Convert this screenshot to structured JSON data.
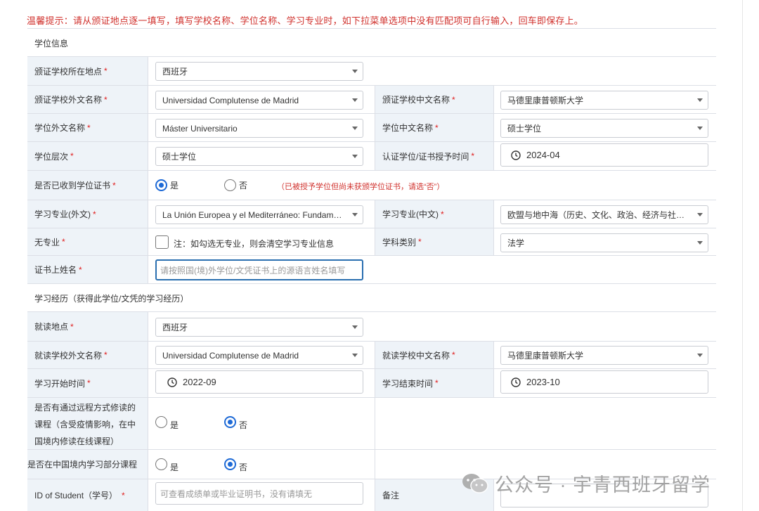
{
  "notice": "温馨提示：请从颁证地点逐一填写，填写学校名称、学位名称、学习专业时，如下拉菜单选项中没有匹配项可自行输入，回车即保存上。",
  "sections": {
    "degree_info": "学位信息",
    "study_history": "学习经历（获得此学位/文凭的学习经历）"
  },
  "required_mark": "*",
  "degree": {
    "location_label": "颁证学校所在地点",
    "location_value": "西班牙",
    "school_foreign_label": "颁证学校外文名称",
    "school_foreign_value": "Universidad Complutense de Madrid",
    "school_cn_label": "颁证学校中文名称",
    "school_cn_value": "马德里康普顿斯大学",
    "degree_foreign_label": "学位外文名称",
    "degree_foreign_value": "Máster Universitario",
    "degree_cn_label": "学位中文名称",
    "degree_cn_value": "硕士学位",
    "level_label": "学位层次",
    "level_value": "硕士学位",
    "cert_date_label": "认证学位/证书授予时间",
    "cert_date_value": "2024-04",
    "received_label": "是否已收到学位证书",
    "received_yes": "是",
    "received_no": "否",
    "received_hint": "（已被授予学位但尚未获颁学位证书，请选“否”）",
    "major_foreign_label": "学习专业(外文)",
    "major_foreign_value": "La Unión Europea y el Mediterráneo: Fundame···",
    "major_cn_label": "学习专业(中文)",
    "major_cn_value": "欧盟与地中海（历史、文化、政治、经济与社会···",
    "no_major_label": "无专业",
    "no_major_note": "注：如勾选无专业，则会清空学习专业信息",
    "discipline_label": "学科类别",
    "discipline_value": "法学",
    "cert_name_label": "证书上姓名",
    "cert_name_placeholder": "请按照国(境)外学位/文凭证书上的源语言姓名填写"
  },
  "study": {
    "location_label": "就读地点",
    "location_value": "西班牙",
    "school_foreign_label": "就读学校外文名称",
    "school_foreign_value": "Universidad Complutense de Madrid",
    "school_cn_label": "就读学校中文名称",
    "school_cn_value": "马德里康普顿斯大学",
    "start_label": "学习开始时间",
    "start_value": "2022-09",
    "end_label": "学习结束时间",
    "end_value": "2023-10",
    "remote_label_1": "是否有通过远程方式修读的",
    "remote_label_2": "课程（含受疫情影响，在中",
    "remote_label_3": "国境内修读在线课程）",
    "remote_yes": "是",
    "remote_no": "否",
    "china_label": "是否在中国境内学习部分课程",
    "china_yes": "是",
    "china_no": "否",
    "student_id_label": "ID of Student（学号）",
    "student_id_placeholder": "可查看成绩单或毕业证明书，没有请填无",
    "remarks_label": "备注"
  },
  "watermark": "公众号 · 宇青西班牙留学",
  "colors": {
    "accent": "#1e6ad6",
    "danger": "#d0312d",
    "label_bg": "#eef3f8",
    "border": "#dcdfe6"
  }
}
